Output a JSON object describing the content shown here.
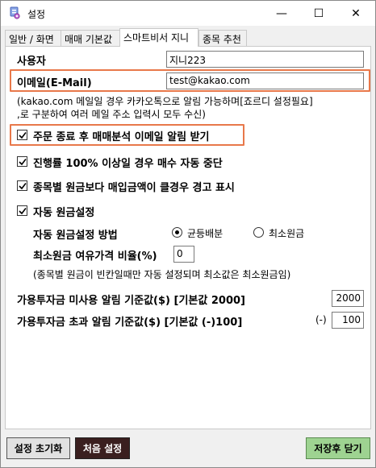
{
  "window": {
    "title": "설정",
    "minimize_glyph": "—",
    "maximize_glyph": "☐",
    "close_glyph": "✕",
    "app_icon": "settings-app-icon"
  },
  "tabs": [
    {
      "label": "일반 / 화면",
      "active": false
    },
    {
      "label": "매매 기본값",
      "active": false
    },
    {
      "label": "스마트비서 지니",
      "active": true
    },
    {
      "label": "종목 추천",
      "active": false
    }
  ],
  "form": {
    "user": {
      "label": "사용자",
      "value": "지니223"
    },
    "email": {
      "label": "이메일(E-Mail)",
      "value": "test@kakao.com"
    },
    "help_line1": "(kakao.com 메일일 경우 카카오톡으로 알림 가능하며[죠르디 설정필요]",
    "help_line2": ",로 구분하여 여러 메일 주소 입력시 모두 수신)",
    "checkboxes": {
      "order_email": {
        "label": "주문 종료 후 매매분석 이메일 알림 받기",
        "checked": true
      },
      "stop_buy": {
        "label": "진행률 100% 이상일 경우 매수 자동 중단",
        "checked": true
      },
      "warn_price": {
        "label": "종목별 원금보다 매입금액이 클경우 경고 표시",
        "checked": true
      },
      "auto_principal": {
        "label": "자동 원금설정",
        "checked": true
      }
    },
    "method": {
      "label": "자동 원금설정 방법",
      "options": [
        {
          "label": "균등배분",
          "selected": true
        },
        {
          "label": "최소원금",
          "selected": false
        }
      ]
    },
    "margin": {
      "label": "최소원금 여유가격 비율(%)",
      "value": "0"
    },
    "margin_note": "(종목별 원금이 빈칸일때만 자동 설정되며 최소값은 최소원금임)",
    "unused_alert": {
      "label": "가용투자금 미사용 알림 기준값($) [기본값 2000]",
      "value": "2000"
    },
    "excess_alert": {
      "label": "가용투자금 초과 알림 기준값($) [기본값 (-)100]",
      "prefix": "(-)",
      "value": "100"
    }
  },
  "buttons": {
    "reset": "설정 초기화",
    "first_setup": "처음 설정",
    "save_close": "저장후 닫기"
  },
  "colors": {
    "highlight": "#e8784a",
    "first_setup_bg": "#3a1f1f",
    "save_bg": "#9ed391",
    "reset_bg": "#e1e1e1"
  }
}
